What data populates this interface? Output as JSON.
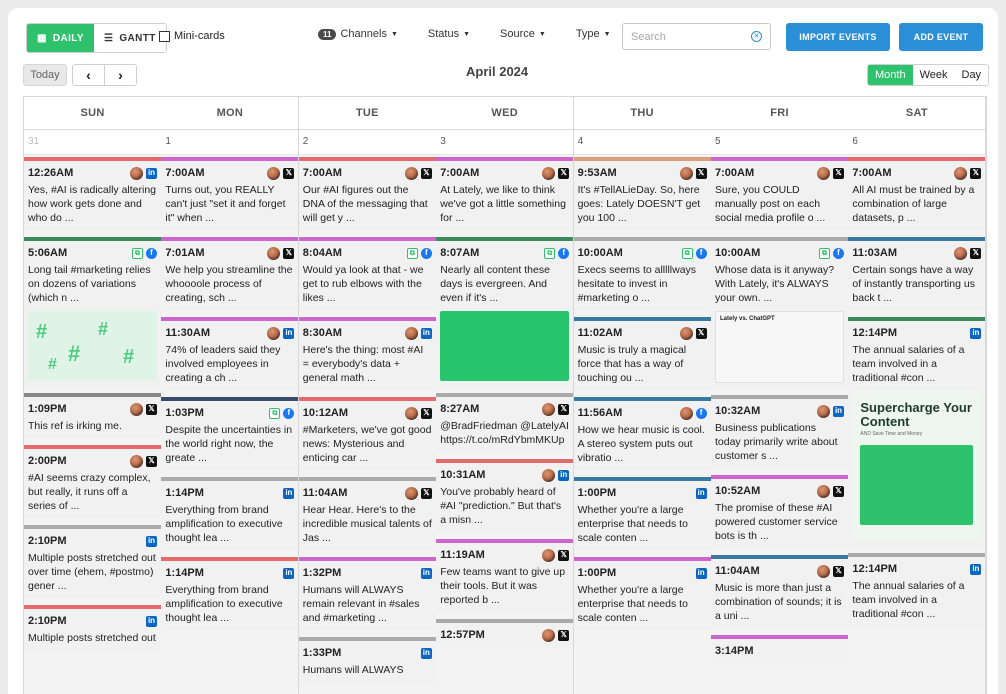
{
  "toolbar": {
    "daily_label": "DAILY",
    "gantt_label": "GANTT",
    "minicards_label": "Mini-cards",
    "channels_count": "11",
    "channels_label": "Channels",
    "status_label": "Status",
    "source_label": "Source",
    "type_label": "Type",
    "search_placeholder": "Search",
    "import_label": "IMPORT EVENTS",
    "add_label": "ADD EVENT"
  },
  "nav": {
    "today_label": "Today",
    "prev": "‹",
    "next": "›",
    "month_title": "April 2024",
    "scale": [
      "Month",
      "Week",
      "Day"
    ],
    "active_scale": "Month"
  },
  "colors": {
    "accent_green": "#2dc26b",
    "accent_blue": "#2a8fd6"
  },
  "days": [
    {
      "name": "SUN",
      "num": "31",
      "faded": true,
      "posts": [
        {
          "time": "12:26AM",
          "text": "Yes, #AI is radically altering how work gets done and who do ...",
          "icons": [
            "avatar",
            "linkedin"
          ],
          "bar": "#e36b6b"
        },
        {
          "time": "5:06AM",
          "text": "Long tail #marketing relies on dozens of variations (which n ...",
          "icons": [
            "copy",
            "facebook"
          ],
          "bar": "#3a8a5a",
          "image": "hash"
        },
        {
          "time": "1:09PM",
          "text": "This ref is irking me.",
          "icons": [
            "avatar",
            "x"
          ],
          "bar": "#888888"
        },
        {
          "time": "2:00PM",
          "text": "#AI seems crazy complex, but really, it runs off a series of ...",
          "icons": [
            "avatar",
            "x"
          ],
          "bar": "#e36b6b"
        },
        {
          "time": "2:10PM",
          "text": "Multiple posts stretched out over time (ehem, #postmo) gener ...",
          "icons": [
            "linkedin"
          ],
          "bar": "#aaaaaa"
        },
        {
          "time": "2:10PM",
          "text": "Multiple posts stretched out",
          "icons": [
            "linkedin"
          ],
          "bar": "#e36b6b"
        }
      ]
    },
    {
      "name": "MON",
      "num": "1",
      "faded": false,
      "posts": [
        {
          "time": "7:00AM",
          "text": "Turns out, you REALLY can't just \"set it and forget it\" when ...",
          "icons": [
            "avatar",
            "x"
          ],
          "bar": "#cc66cc"
        },
        {
          "time": "7:01AM",
          "text": "We help you streamline the whoooole process of creating, sch ...",
          "icons": [
            "avatar",
            "x"
          ],
          "bar": "#cc66cc"
        },
        {
          "time": "11:30AM",
          "text": "74% of leaders said they involved employees in creating a ch ...",
          "icons": [
            "avatar",
            "linkedin"
          ],
          "bar": "#cc66cc"
        },
        {
          "time": "1:03PM",
          "text": "Despite the uncertainties in the world right now, the greate ...",
          "icons": [
            "copy",
            "facebook"
          ],
          "bar": "#3a4a6a"
        },
        {
          "time": "1:14PM",
          "text": "Everything from brand amplification to executive thought lea ...",
          "icons": [
            "linkedin"
          ],
          "bar": "#aaaaaa"
        },
        {
          "time": "1:14PM",
          "text": "Everything from brand amplification to executive thought lea ...",
          "icons": [
            "linkedin"
          ],
          "bar": "#e36b6b"
        }
      ]
    },
    {
      "name": "TUE",
      "num": "2",
      "faded": false,
      "posts": [
        {
          "time": "7:00AM",
          "text": "Our #AI figures out the DNA of the messaging that will get y ...",
          "icons": [
            "avatar",
            "x"
          ],
          "bar": "#e36b6b"
        },
        {
          "time": "8:04AM",
          "text": "Would ya look at that - we get to rub elbows with the likes ...",
          "icons": [
            "copy",
            "facebook"
          ],
          "bar": "#cc66cc"
        },
        {
          "time": "8:30AM",
          "text": "Here's the thing: most #AI = everybody's data + general math ...",
          "icons": [
            "avatar",
            "linkedin"
          ],
          "bar": "#cc66cc"
        },
        {
          "time": "10:12AM",
          "text": "#Marketers, we've got good news: Mysterious and enticing car ...",
          "icons": [
            "avatar",
            "x"
          ],
          "bar": "#e36b6b"
        },
        {
          "time": "11:04AM",
          "text": "Hear Hear. Here's to the incredible musical talents of Jas ...",
          "icons": [
            "avatar",
            "x"
          ],
          "bar": "#aaaaaa"
        },
        {
          "time": "1:32PM",
          "text": "Humans will ALWAYS remain relevant in #sales and #marketing ...",
          "icons": [
            "linkedin"
          ],
          "bar": "#cc66cc"
        },
        {
          "time": "1:33PM",
          "text": "Humans will ALWAYS",
          "icons": [
            "linkedin"
          ],
          "bar": "#aaaaaa"
        }
      ]
    },
    {
      "name": "WED",
      "num": "3",
      "faded": false,
      "posts": [
        {
          "time": "7:00AM",
          "text": "At Lately, we like to think we've got a little something for ...",
          "icons": [
            "avatar",
            "x"
          ],
          "bar": "#cc66cc"
        },
        {
          "time": "8:07AM",
          "text": "Nearly all content these days is evergreen. And even if it's ...",
          "icons": [
            "copy",
            "facebook"
          ],
          "bar": "#3a8a5a",
          "image": "green"
        },
        {
          "time": "8:27AM",
          "text": "@BradFriedman @LatelyAI https://t.co/mRdYbmMKUp",
          "icons": [
            "avatar",
            "x"
          ],
          "bar": "#aaaaaa"
        },
        {
          "time": "10:31AM",
          "text": "You've probably heard of #AI \"prediction.\" But that's a misn ...",
          "icons": [
            "avatar",
            "linkedin"
          ],
          "bar": "#e36b6b"
        },
        {
          "time": "11:19AM",
          "text": "Few teams want to give up their tools. But it was reported b ...",
          "icons": [
            "avatar",
            "x"
          ],
          "bar": "#cc66cc"
        },
        {
          "time": "12:57PM",
          "text": "",
          "icons": [
            "avatar",
            "x"
          ],
          "bar": "#aaaaaa"
        }
      ]
    },
    {
      "name": "THU",
      "num": "4",
      "faded": false,
      "posts": [
        {
          "time": "9:53AM",
          "text": "It's #TellALieDay. So, here goes: Lately DOESN'T get you 100 ...",
          "icons": [
            "avatar",
            "x"
          ],
          "bar": "#d8a080"
        },
        {
          "time": "10:00AM",
          "text": "Execs seems to alllllways hesitate to invest in #marketing o ...",
          "icons": [
            "copy",
            "facebook"
          ],
          "bar": "#aaaaaa"
        },
        {
          "time": "11:02AM",
          "text": "Music is truly a magical force that has a way of touching ou ...",
          "icons": [
            "avatar",
            "x"
          ],
          "bar": "#3a7aa0"
        },
        {
          "time": "11:56AM",
          "text": "How we hear music is cool. A stereo system puts out vibratio ...",
          "icons": [
            "avatar",
            "facebook"
          ],
          "bar": "#3a7aa0"
        },
        {
          "time": "1:00PM",
          "text": "Whether you're a large enterprise that needs to scale conten ...",
          "icons": [
            "linkedin"
          ],
          "bar": "#3a7aa0"
        },
        {
          "time": "1:00PM",
          "text": "Whether you're a large enterprise that needs to scale conten ...",
          "icons": [
            "linkedin"
          ],
          "bar": "#cc66cc"
        }
      ]
    },
    {
      "name": "FRI",
      "num": "5",
      "faded": false,
      "posts": [
        {
          "time": "7:00AM",
          "text": "Sure, you COULD manually post on each social media profile o ...",
          "icons": [
            "avatar",
            "x"
          ],
          "bar": "#cc66cc"
        },
        {
          "time": "10:00AM",
          "text": "Whose data is it anyway? With Lately, it's ALWAYS your own. ...",
          "icons": [
            "copy",
            "facebook"
          ],
          "bar": "#aaaaaa",
          "image": "lately",
          "image_caption": "Lately vs. ChatGPT"
        },
        {
          "time": "10:32AM",
          "text": "Business publications today primarily write about customer s ...",
          "icons": [
            "avatar",
            "linkedin"
          ],
          "bar": "#aaaaaa"
        },
        {
          "time": "10:52AM",
          "text": "The promise of these #AI powered customer service bots is th ...",
          "icons": [
            "avatar",
            "x"
          ],
          "bar": "#cc66cc"
        },
        {
          "time": "11:04AM",
          "text": "Music is more than just a combination of sounds; it is a uni ...",
          "icons": [
            "avatar",
            "x"
          ],
          "bar": "#3a7aa0"
        },
        {
          "time": "3:14PM",
          "text": "",
          "icons": [],
          "bar": "#cc66cc"
        }
      ]
    },
    {
      "name": "SAT",
      "num": "6",
      "faded": false,
      "posts": [
        {
          "time": "7:00AM",
          "text": "All AI must be trained by a combination of large datasets, p ...",
          "icons": [
            "avatar",
            "x"
          ],
          "bar": "#e36b6b"
        },
        {
          "time": "11:03AM",
          "text": "Certain songs have a way of instantly transporting us back t ...",
          "icons": [
            "avatar",
            "x"
          ],
          "bar": "#3a7aa0"
        },
        {
          "time": "12:14PM",
          "text": "The annual salaries of a team involved in a traditional #con ...",
          "icons": [
            "linkedin"
          ],
          "bar": "#3a8a5a",
          "image": "supercharge",
          "image_title": "Supercharge Your Content",
          "image_sub": "AND Save Time and Money"
        },
        {
          "time": "12:14PM",
          "text": "The annual salaries of a team involved in a traditional #con ...",
          "icons": [
            "linkedin"
          ],
          "bar": "#aaaaaa"
        }
      ]
    }
  ]
}
